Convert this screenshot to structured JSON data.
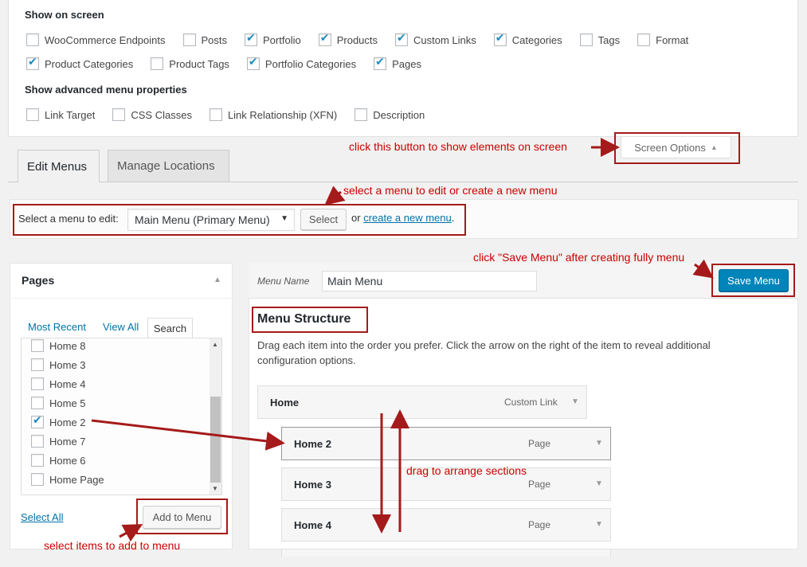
{
  "screen_options": {
    "show_heading": "Show on screen",
    "row1": [
      {
        "label": "WooCommerce Endpoints",
        "checked": false
      },
      {
        "label": "Posts",
        "checked": false
      },
      {
        "label": "Portfolio",
        "checked": true
      },
      {
        "label": "Products",
        "checked": true
      },
      {
        "label": "Custom Links",
        "checked": true
      },
      {
        "label": "Categories",
        "checked": true
      },
      {
        "label": "Tags",
        "checked": false
      },
      {
        "label": "Format",
        "checked": false
      }
    ],
    "row2": [
      {
        "label": "Product Categories",
        "checked": true
      },
      {
        "label": "Product Tags",
        "checked": false
      },
      {
        "label": "Portfolio Categories",
        "checked": true
      },
      {
        "label": "Pages",
        "checked": true
      }
    ],
    "advanced_heading": "Show advanced menu properties",
    "row3": [
      {
        "label": "Link Target",
        "checked": false
      },
      {
        "label": "CSS Classes",
        "checked": false
      },
      {
        "label": "Link Relationship (XFN)",
        "checked": false
      },
      {
        "label": "Description",
        "checked": false
      }
    ],
    "button_label": "Screen Options"
  },
  "tabs": {
    "edit": "Edit Menus",
    "manage": "Manage Locations"
  },
  "manage_bar": {
    "select_label": "Select a menu to edit:",
    "selected_menu": "Main Menu (Primary Menu)",
    "select_button": "Select",
    "or_text": "or",
    "create_link": "create a new menu",
    "period": "."
  },
  "pages_box": {
    "title": "Pages",
    "tab_recent": "Most Recent",
    "tab_all": "View All",
    "tab_search": "Search",
    "items": [
      {
        "label": "Home 8",
        "checked": false
      },
      {
        "label": "Home 3",
        "checked": false
      },
      {
        "label": "Home 4",
        "checked": false
      },
      {
        "label": "Home 5",
        "checked": false
      },
      {
        "label": "Home 2",
        "checked": true
      },
      {
        "label": "Home 7",
        "checked": false
      },
      {
        "label": "Home 6",
        "checked": false
      },
      {
        "label": "Home Page",
        "checked": false
      }
    ],
    "select_all": "Select All",
    "add_button": "Add to Menu"
  },
  "menu_editor": {
    "name_label": "Menu Name",
    "name_value": "Main Menu",
    "save_button": "Save Menu",
    "structure_title": "Menu Structure",
    "instructions": "Drag each item into the order you prefer. Click the arrow on the right of the item to reveal additional configuration options.",
    "items": [
      {
        "title": "Home",
        "type": "Custom Link"
      },
      {
        "title": "Home 2",
        "type": "Page"
      },
      {
        "title": "Home 3",
        "type": "Page"
      },
      {
        "title": "Home 4",
        "type": "Page"
      }
    ]
  },
  "annotations": {
    "screen_options": "click this button to show elements on screen",
    "select_menu": "select a menu to edit or create a new menu",
    "save_menu": "click \"Save Menu\" after creating fully menu",
    "drag": "drag to arrange sections",
    "add_items": "select items to add to menu"
  },
  "colors": {
    "annotation_red": "#c00000",
    "primary_button": "#0085ba",
    "link": "#0073aa"
  }
}
